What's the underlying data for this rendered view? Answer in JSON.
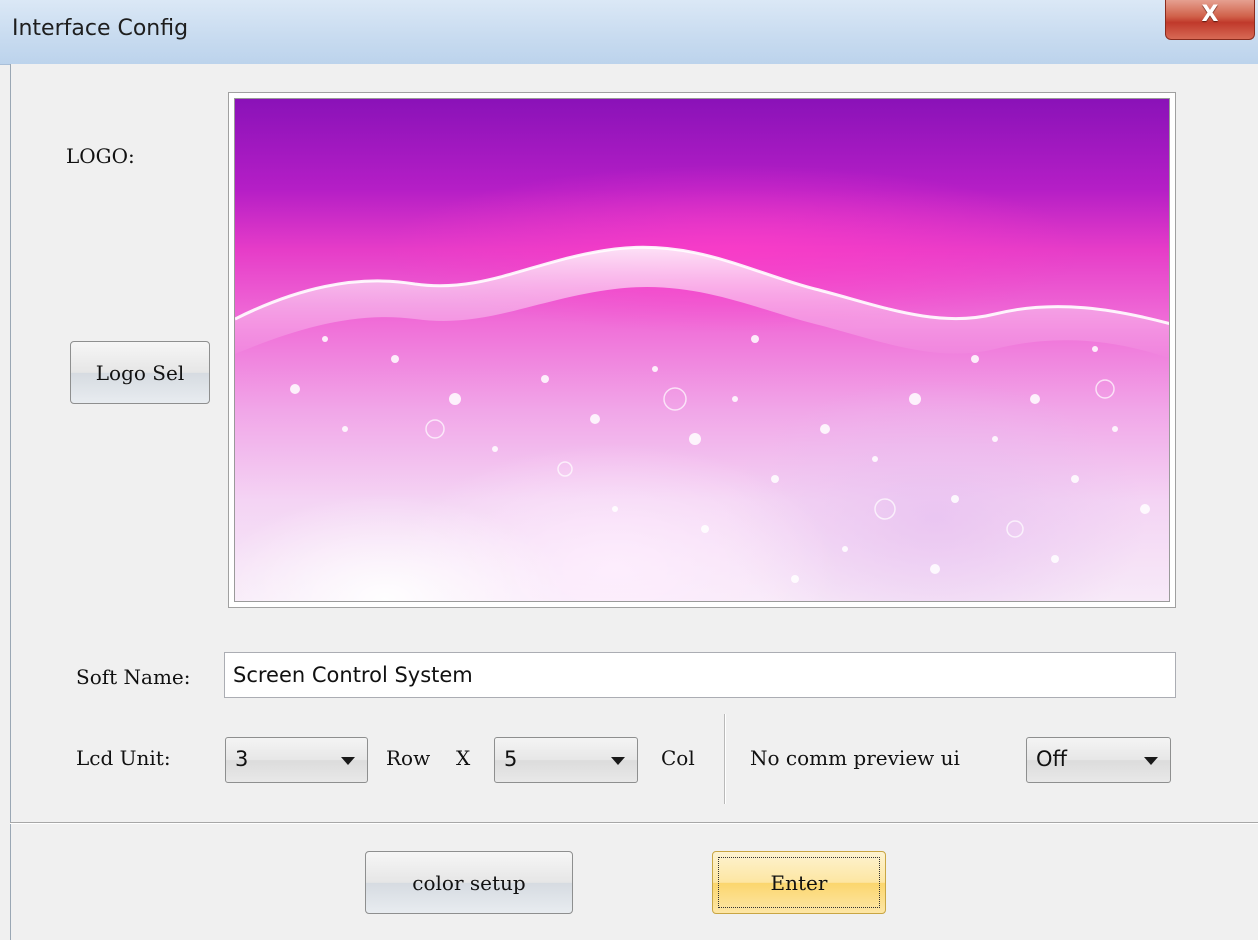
{
  "window": {
    "title": "Interface Config",
    "close_label": "X"
  },
  "logo": {
    "label": "LOGO:",
    "select_button": "Logo Sel"
  },
  "soft_name": {
    "label": "Soft Name:",
    "value": "Screen Control System"
  },
  "lcd_unit": {
    "label": "Lcd Unit:",
    "rows_value": "3",
    "row_label": "Row",
    "x_label": "X",
    "cols_value": "5",
    "col_label": "Col"
  },
  "preview": {
    "label": "No comm preview ui",
    "value": "Off"
  },
  "footer": {
    "color_setup_label": "color setup",
    "enter_label": "Enter"
  },
  "colors": {
    "titlebar": "#c9dcf0",
    "close_button": "#c0392b",
    "primary_button": "#fbd66e",
    "background": "#f0f0f0"
  }
}
